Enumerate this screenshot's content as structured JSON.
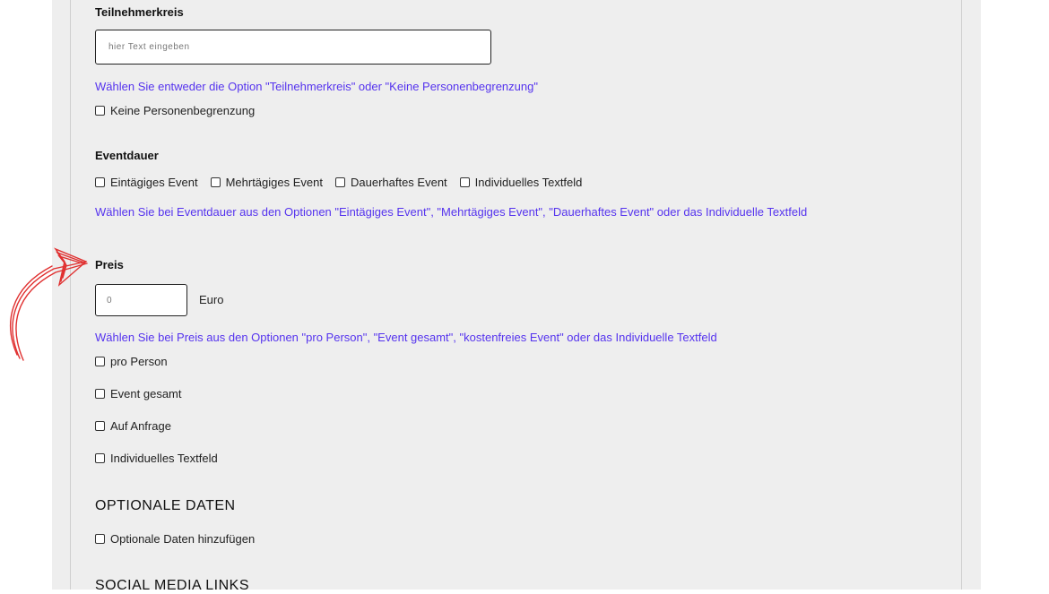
{
  "participants": {
    "label": "Teilnehmerkreis",
    "placeholder": "hier Text eingeben",
    "hint": "Wählen Sie entweder die Option \"Teilnehmerkreis\" oder \"Keine Personenbegrenzung\"",
    "no_limit_label": "Keine Personenbegrenzung"
  },
  "duration": {
    "label": "Eventdauer",
    "options": [
      "Eintägiges Event",
      "Mehrtägiges Event",
      "Dauerhaftes Event",
      "Individuelles Textfeld"
    ],
    "hint": "Wählen Sie bei Eventdauer aus den Optionen \"Eintägiges Event\", \"Mehrtägiges Event\", \"Dauerhaftes Event\" oder das Individuelle Textfeld"
  },
  "price": {
    "label": "Preis",
    "value": "0",
    "currency": "Euro",
    "hint": "Wählen Sie bei Preis aus den Optionen \"pro Person\", \"Event gesamt\", \"kostenfreies Event\" oder das Individuelle Textfeld",
    "options": [
      "pro Person",
      "Event gesamt",
      "Auf Anfrage",
      "Individuelles Textfeld"
    ]
  },
  "optional": {
    "title": "OPTIONALE DATEN",
    "checkbox_label": "Optionale Daten hinzufügen"
  },
  "social": {
    "title": "SOCIAL MEDIA LINKS"
  },
  "annotation": {
    "arrow_color": "#e03030"
  }
}
